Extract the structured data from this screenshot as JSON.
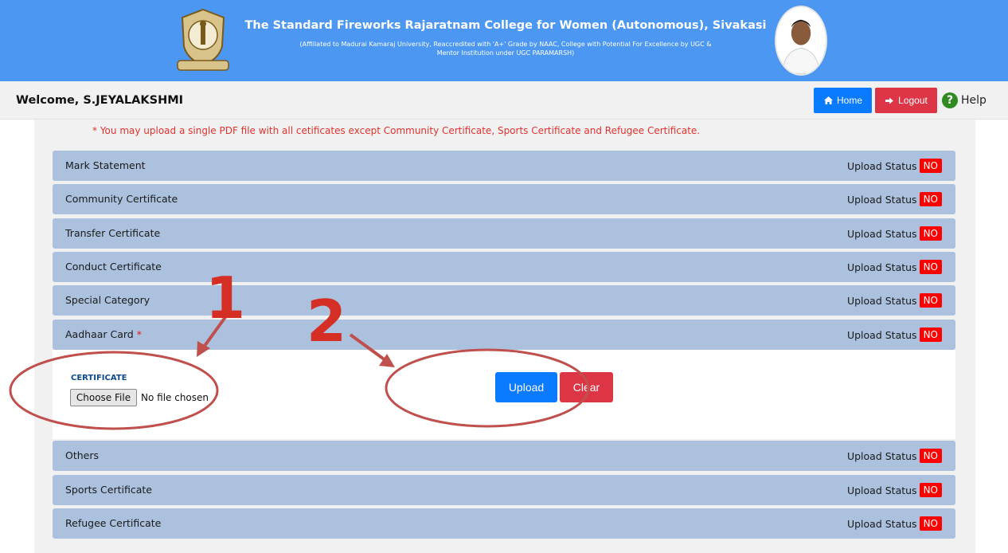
{
  "header": {
    "college_title": "The Standard Fireworks Rajaratnam College for Women (Autonomous), Sivakasi",
    "subtitle_line1": "(Affiliated to Madurai Kamaraj University, Reaccredited with 'A+' Grade by NAAC, College with Potential For Excellence by UGC &",
    "subtitle_line2": "Mentor Institution under UGC PARAMARSH)",
    "logo_icon": "college-crest-icon",
    "portrait_icon": "founder-portrait-icon"
  },
  "topbar": {
    "welcome": "Welcome, S.JEYALAKSHMI",
    "home_label": "Home",
    "logout_label": "Logout",
    "help_label": "Help",
    "home_color": "#0a7bff",
    "logout_color": "#dc3545"
  },
  "note": "* You may upload a single PDF file with all cetificates except Community Certificate, Sports Certificate and Refugee Certificate.",
  "status_label": "Upload Status",
  "status_value": "NO",
  "sections": [
    {
      "label": "Mark Statement",
      "required": ""
    },
    {
      "label": "Community Certificate",
      "required": ""
    },
    {
      "label": "Transfer Certificate",
      "required": ""
    },
    {
      "label": "Conduct Certificate",
      "required": ""
    },
    {
      "label": "Special Category",
      "required": ""
    },
    {
      "label": "Aadhaar Card",
      "required": "*"
    },
    {
      "label": "Others",
      "required": ""
    },
    {
      "label": "Sports Certificate",
      "required": ""
    },
    {
      "label": "Refugee Certificate",
      "required": ""
    }
  ],
  "upload_panel": {
    "certificate_label": "CERTIFICATE",
    "choose_file": "Choose File",
    "no_file": "No file chosen",
    "upload_button": "Upload",
    "clear_button": "Clear"
  },
  "annotations": {
    "marker_1": "1",
    "marker_2": "2",
    "color": "#d52e25"
  }
}
